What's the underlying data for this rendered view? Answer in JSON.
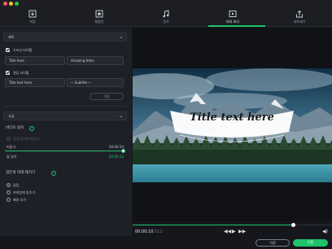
{
  "window": {
    "title": ""
  },
  "colors": {
    "accent": "#1fc36a",
    "panel": "#1e2027",
    "background": "#15171d"
  },
  "toolbar": {
    "tabs": [
      {
        "label": "파일",
        "icon": "import-icon",
        "active": false
      },
      {
        "label": "템플릿",
        "icon": "template-icon",
        "active": false
      },
      {
        "label": "음악",
        "icon": "music-icon",
        "active": false
      },
      {
        "label": "미리 보기",
        "icon": "preview-icon",
        "active": true
      },
      {
        "label": "내보내기",
        "icon": "export-icon",
        "active": false
      }
    ]
  },
  "left_panel": {
    "title_dropdown": "제목",
    "opening_checkbox_label": "오프닝 타이틀",
    "opening_fields": [
      "Title here",
      "Amazing titles"
    ],
    "ending_checkbox_label": "엔딩 타이틀",
    "ending_fields": [
      "Title text here",
      "~ Subtitle ~"
    ],
    "apply_button": "적용",
    "advanced_dropdown": "고급",
    "video_length_title": "비디오 길이",
    "auto_adjust_label": "음악 길이에 맞추기",
    "original_label": "미듐식",
    "original_value": "00:00:34",
    "total_label": "총 길이",
    "total_value": "00:00:12",
    "length_slider_percent": 100,
    "black_bars_title": "검은색 막대 제거기",
    "radios": [
      {
        "label": "없음",
        "selected": true
      },
      {
        "label": "프레임에 맞추기",
        "selected": false
      },
      {
        "label": "배경 추가",
        "selected": false
      }
    ]
  },
  "preview": {
    "title_text": "Title text here",
    "subtitle_text": "~ Subtitle ~"
  },
  "playback": {
    "current_time": "00:00:10",
    "current_frame": ".011",
    "progress_percent": 81
  },
  "footer": {
    "prev_button": "이전",
    "next_button": "다음"
  }
}
